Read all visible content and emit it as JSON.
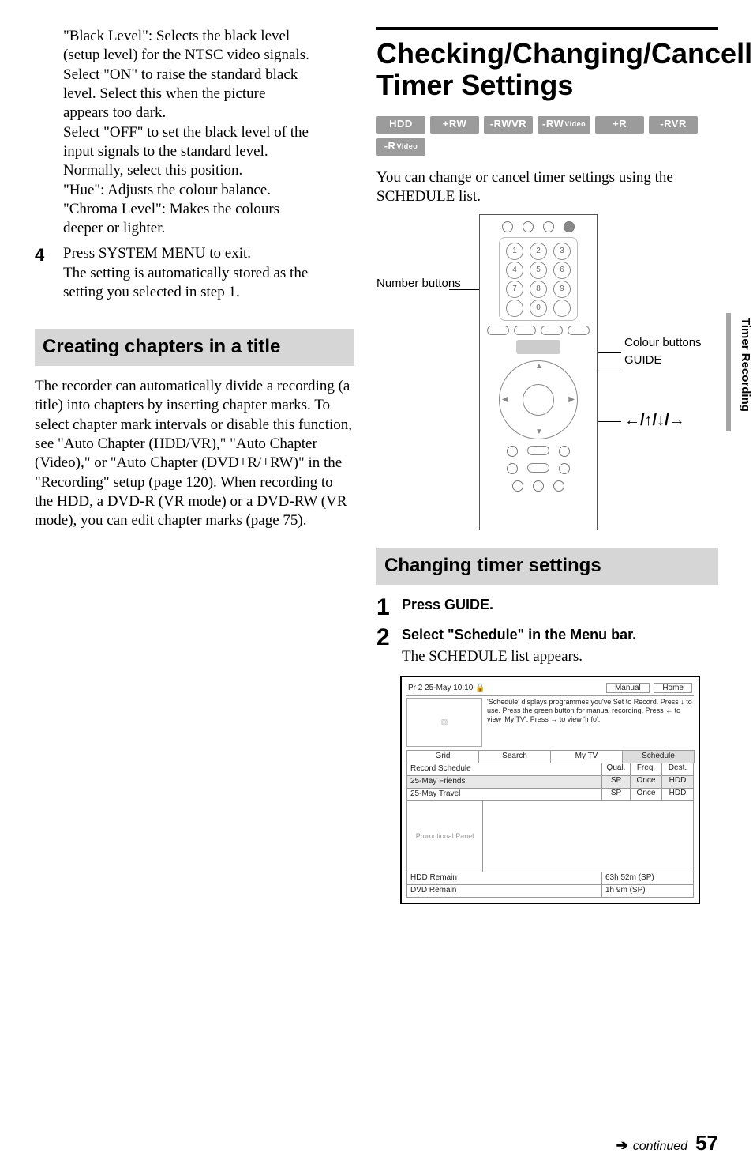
{
  "left": {
    "para1_l1": "\"Black Level\": Selects the black level",
    "para1_l2": "(setup level) for the NTSC video signals.",
    "para1_l3": "Select \"ON\" to raise the standard black",
    "para1_l4": "level. Select this when the picture",
    "para1_l5": "appears too dark.",
    "para1_l6": "Select \"OFF\" to set the black level of the",
    "para1_l7": "input signals to the standard level.",
    "para1_l8": "Normally, select this position.",
    "para1_l9": "\"Hue\": Adjusts the colour balance.",
    "para1_l10": "\"Chroma Level\": Makes the colours",
    "para1_l11": "deeper or lighter.",
    "step4_num": "4",
    "step4_l1": "Press SYSTEM MENU to exit.",
    "step4_l2": "The setting is automatically stored as the",
    "step4_l3": "setting you selected in step 1.",
    "section_bar": "Creating chapters in a title",
    "para2": "The recorder can automatically divide a recording (a title) into chapters by inserting chapter marks. To select chapter mark intervals or disable this function, see \"Auto Chapter (HDD/VR),\" \"Auto Chapter (Video),\" or \"Auto Chapter (DVD+R/+RW)\" in the \"Recording\" setup (page 120). When recording to the HDD, a DVD-R (VR mode) or a DVD-RW (VR mode), you can edit chapter marks (page 75)."
  },
  "right": {
    "title": "Checking/Changing/Cancelling Timer Settings",
    "badges": {
      "hdd": "HDD",
      "plus_rw": "+RW",
      "minus_rwvr": "-RWVR",
      "minus_rwvideo_a": "-RW",
      "minus_rwvideo_b": "Video",
      "plus_r": "+R",
      "minus_rvr": "-RVR",
      "minus_rvideo_a": "-R",
      "minus_rvideo_b": "Video"
    },
    "intro": "You can change or cancel timer settings using the SCHEDULE list.",
    "remote": {
      "number_buttons": "Number buttons",
      "colour_buttons": "Colour buttons",
      "guide": "GUIDE",
      "arrow_glyph": "←/↑/↓/→"
    },
    "section_bar": "Changing timer settings",
    "step1_num": "1",
    "step1_head": "Press GUIDE.",
    "step2_num": "2",
    "step2_head": "Select \"Schedule\" in the Menu bar.",
    "step2_body": "The SCHEDULE list appears.",
    "schedule": {
      "topbar_left": "Pr 2    25-May 10:10",
      "lock_glyph": "🔒",
      "topbar_manual": "Manual",
      "topbar_home": "Home",
      "info_text": "'Schedule' displays programmes you've Set to Record. Press ↓ to use. Press the green button for manual recording. Press ← to view 'My TV'. Press → to view 'Info'.",
      "tabs": {
        "grid": "Grid",
        "search": "Search",
        "mytv": "My TV",
        "schedule": "Schedule"
      },
      "header": {
        "c1": "Record Schedule",
        "c2": "Qual.",
        "c3": "Freq.",
        "c4": "Dest."
      },
      "rows": [
        {
          "c1": "25-May  Friends",
          "c2": "SP",
          "c3": "Once",
          "c4": "HDD"
        },
        {
          "c1": "25-May  Travel",
          "c2": "SP",
          "c3": "Once",
          "c4": "HDD"
        }
      ],
      "promo": "Promotional Panel",
      "hdd_remain_label": "HDD Remain",
      "hdd_remain_value": "63h 52m (SP)",
      "dvd_remain_label": "DVD Remain",
      "dvd_remain_value": "1h 9m (SP)"
    }
  },
  "side_tab": "Timer Recording",
  "footer": {
    "arrow": "➔",
    "continued": "continued",
    "page": "57"
  }
}
